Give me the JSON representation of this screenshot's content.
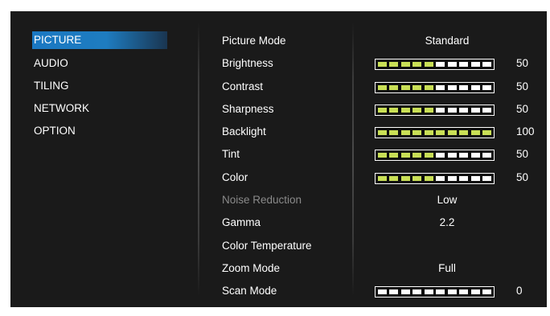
{
  "sidebar": {
    "items": [
      {
        "label": "PICTURE",
        "active": true
      },
      {
        "label": "AUDIO",
        "active": false
      },
      {
        "label": "TILING",
        "active": false
      },
      {
        "label": "NETWORK",
        "active": false
      },
      {
        "label": "OPTION",
        "active": false
      }
    ]
  },
  "colors": {
    "background": "#1a1a1a",
    "active_tab": "#1a78c2",
    "bar_fill": "#c9df56",
    "bar_empty": "#ffffff",
    "disabled_text": "#8a8a8a"
  },
  "settings": [
    {
      "label": "Picture Mode",
      "type": "text",
      "value": "Standard"
    },
    {
      "label": "Brightness",
      "type": "slider",
      "value": "50",
      "level": 0.5
    },
    {
      "label": "Contrast",
      "type": "slider",
      "value": "50",
      "level": 0.5
    },
    {
      "label": "Sharpness",
      "type": "slider",
      "value": "50",
      "level": 0.5
    },
    {
      "label": "Backlight",
      "type": "slider",
      "value": "100",
      "level": 1.0
    },
    {
      "label": "Tint",
      "type": "slider",
      "value": "50",
      "level": 0.5
    },
    {
      "label": "Color",
      "type": "slider",
      "value": "50",
      "level": 0.5
    },
    {
      "label": "Noise Reduction",
      "type": "text",
      "value": "Low",
      "disabled": true
    },
    {
      "label": "Gamma",
      "type": "text",
      "value": "2.2"
    },
    {
      "label": "Color Temperature",
      "type": "text",
      "value": ""
    },
    {
      "label": "Zoom Mode",
      "type": "text",
      "value": "Full"
    },
    {
      "label": "Scan Mode",
      "type": "slider",
      "value": "0",
      "level": 0.0
    }
  ]
}
